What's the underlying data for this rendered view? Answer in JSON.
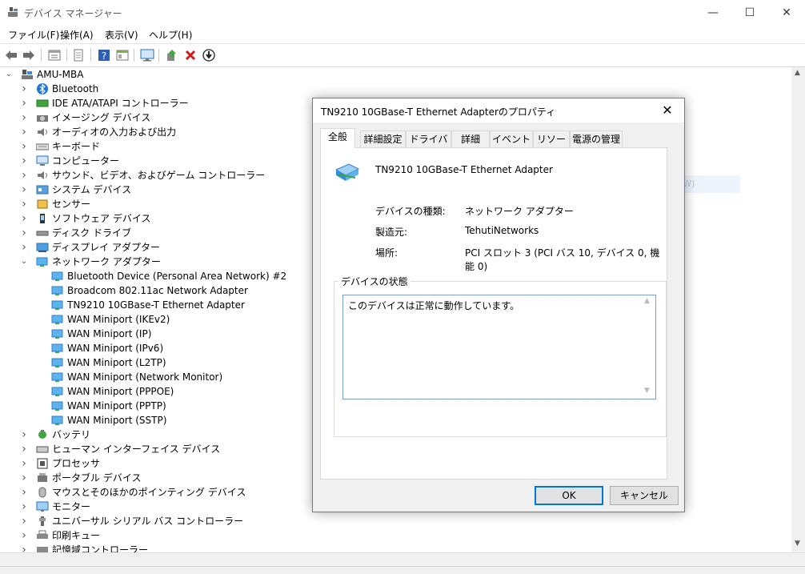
{
  "window": {
    "title": "デバイス マネージャー",
    "minimize": "—",
    "maximize": "☐",
    "close": "✕"
  },
  "menu": [
    "ファイル(F)",
    "操作(A)",
    "表示(V)",
    "ヘルプ(H)"
  ],
  "tree": {
    "root": "AMU-MBA",
    "categories": [
      {
        "label": "Bluetooth",
        "icon": "bluetooth-icon"
      },
      {
        "label": "IDE ATA/ATAPI コントローラー",
        "icon": "ide-controller-icon"
      },
      {
        "label": "イメージング デバイス",
        "icon": "camera-icon"
      },
      {
        "label": "オーディオの入力および出力",
        "icon": "speaker-icon"
      },
      {
        "label": "キーボード",
        "icon": "keyboard-icon"
      },
      {
        "label": "コンピューター",
        "icon": "computer-icon"
      },
      {
        "label": "サウンド、ビデオ、およびゲーム コントローラー",
        "icon": "speaker-icon"
      },
      {
        "label": "システム デバイス",
        "icon": "system-device-icon"
      },
      {
        "label": "センサー",
        "icon": "sensor-icon"
      },
      {
        "label": "ソフトウェア デバイス",
        "icon": "software-device-icon"
      },
      {
        "label": "ディスク ドライブ",
        "icon": "disk-drive-icon"
      },
      {
        "label": "ディスプレイ アダプター",
        "icon": "display-adapter-icon"
      },
      {
        "label": "ネットワーク アダプター",
        "icon": "network-adapter-icon",
        "expanded": true
      }
    ],
    "network_children": [
      "Bluetooth Device (Personal Area Network) #2",
      "Broadcom 802.11ac Network Adapter",
      "TN9210 10GBase-T Ethernet Adapter",
      "WAN Miniport (IKEv2)",
      "WAN Miniport (IP)",
      "WAN Miniport (IPv6)",
      "WAN Miniport (L2TP)",
      "WAN Miniport (Network Monitor)",
      "WAN Miniport (PPPOE)",
      "WAN Miniport (PPTP)",
      "WAN Miniport (SSTP)"
    ],
    "categories_after": [
      {
        "label": "バッテリ",
        "icon": "battery-icon"
      },
      {
        "label": "ヒューマン インターフェイス デバイス",
        "icon": "hid-icon"
      },
      {
        "label": "プロセッサ",
        "icon": "processor-icon"
      },
      {
        "label": "ポータブル デバイス",
        "icon": "portable-device-icon"
      },
      {
        "label": "マウスとそのほかのポインティング デバイス",
        "icon": "mouse-icon"
      },
      {
        "label": "モニター",
        "icon": "monitor-icon"
      },
      {
        "label": "ユニバーサル シリアル バス コントローラー",
        "icon": "usb-icon"
      },
      {
        "label": "印刷キュー",
        "icon": "printer-icon"
      },
      {
        "label": "記憶域コントローラー",
        "icon": "storage-controller-icon"
      }
    ]
  },
  "ghost_text": "ウィンドウの種類切り替え(W)",
  "dialog": {
    "title": "TN9210 10GBase-T Ethernet Adapterのプロパティ",
    "close": "✕",
    "tabs": [
      "全般",
      "詳細設定",
      "ドライバー",
      "詳細",
      "イベント",
      "リソース",
      "電源の管理"
    ],
    "device_name": "TN9210 10GBase-T Ethernet Adapter",
    "fields": [
      {
        "label": "デバイスの種類:",
        "value": "ネットワーク アダプター"
      },
      {
        "label": "製造元:",
        "value": "TehutiNetworks"
      },
      {
        "label": "場所:",
        "value": "PCI スロット 3 (PCI バス 10, デバイス 0, 機能 0)"
      }
    ],
    "status_group": "デバイスの状態",
    "status_text": "このデバイスは正常に動作しています。",
    "ok": "OK",
    "cancel": "キャンセル"
  },
  "colors": {
    "accent": "#0078d7",
    "network_icon": "#2f8fdc"
  }
}
